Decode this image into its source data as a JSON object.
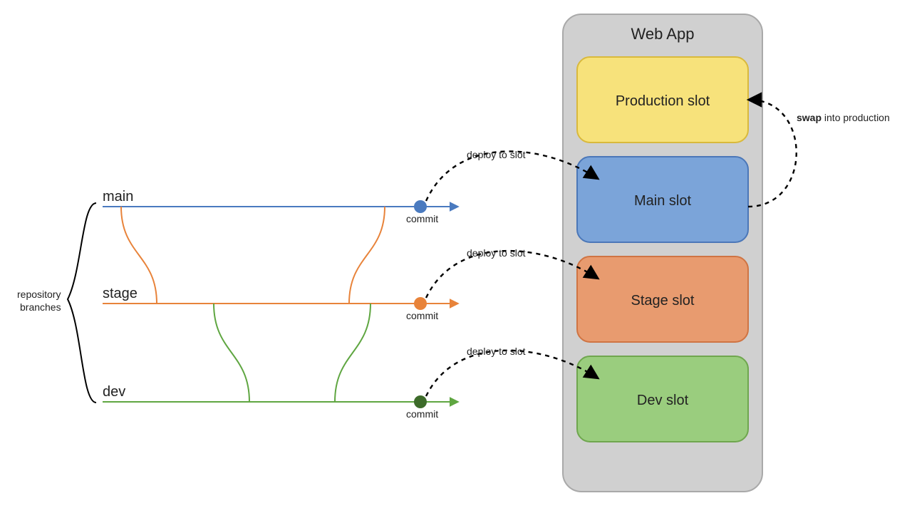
{
  "left_group_label_l1": "repository",
  "left_group_label_l2": "branches",
  "branches": {
    "main": {
      "label": "main",
      "commit": "commit",
      "deploy": "deploy to slot"
    },
    "stage": {
      "label": "stage",
      "commit": "commit",
      "deploy": "deploy to slot"
    },
    "dev": {
      "label": "dev",
      "commit": "commit",
      "deploy": "deploy to slot"
    }
  },
  "webapp_title": "Web App",
  "slots": {
    "production": "Production slot",
    "main": "Main slot",
    "stage": "Stage slot",
    "dev": "Dev slot"
  },
  "swap_bold": "swap",
  "swap_rest": " into production",
  "colors": {
    "main": "#4A7ABF",
    "stage": "#E8833A",
    "dev": "#5FA641",
    "dev_dot": "#3D6B2A",
    "prod_fill": "#F7E27B",
    "prod_stroke": "#D9B93C",
    "main_fill": "#7BA4D9",
    "main_stroke": "#4B77B8",
    "stage_fill": "#E89B6F",
    "stage_stroke": "#CF7443",
    "dev_fill": "#9ACD7E",
    "dev_stroke": "#6FA64E",
    "panel_fill": "#D0D0D0",
    "panel_stroke": "#A9A9A9",
    "dash": "#000"
  }
}
